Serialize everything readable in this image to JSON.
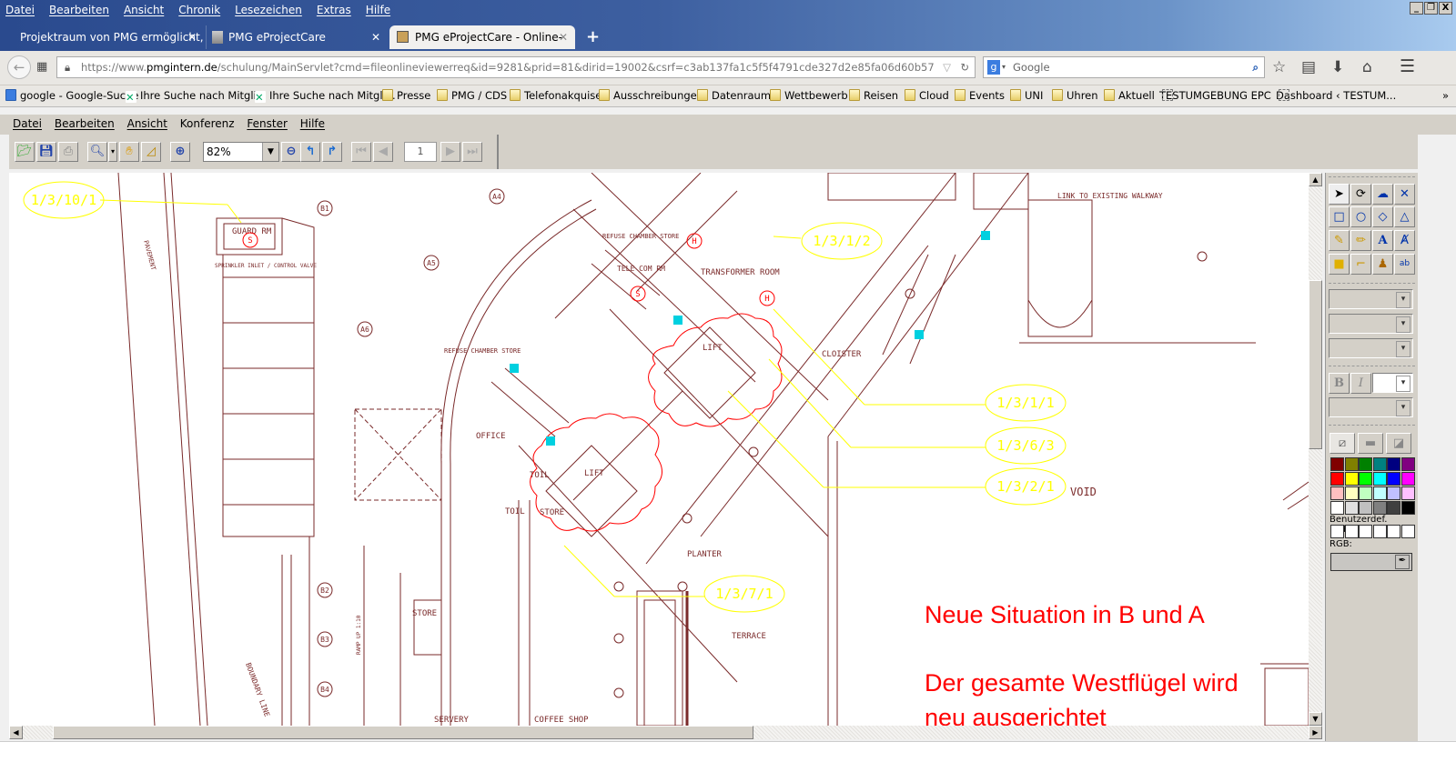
{
  "browser": {
    "menu": [
      "Datei",
      "Bearbeiten",
      "Ansicht",
      "Chronik",
      "Lesezeichen",
      "Extras",
      "Hilfe"
    ],
    "window_controls": [
      "_",
      "❐",
      "X"
    ],
    "tabs": [
      {
        "label": "Projektraum von PMG ermöglicht, ...",
        "active": false
      },
      {
        "label": "PMG eProjectCare (Schulung)",
        "active": false
      },
      {
        "label": "PMG eProjectCare - Online-D...",
        "active": true
      }
    ],
    "new_tab": "+",
    "close_glyph": "✕",
    "url_prefix": "https://www.",
    "url_domain": "pmgintern.de",
    "url_path": "/schulung/MainServlet?cmd=fileonlineviewerreq&id=9281&prid=81&dirid=19002&csrf=c3ab137fa1c5f5f4791cde327d2e85fa06d60b57",
    "search_placeholder": "Google",
    "bookmarks": [
      {
        "label": "google - Google-Suche",
        "icon": "google"
      },
      {
        "label": "Ihre Suche nach Mitgli...",
        "icon": "xing"
      },
      {
        "label": "Ihre Suche nach Mitgli...",
        "icon": "xing"
      },
      {
        "label": "Presse",
        "icon": "folder"
      },
      {
        "label": "PMG / CDS",
        "icon": "folder"
      },
      {
        "label": "Telefonakquise",
        "icon": "folder"
      },
      {
        "label": "Ausschreibungen",
        "icon": "folder"
      },
      {
        "label": "Datenraum",
        "icon": "folder"
      },
      {
        "label": "Wettbewerb",
        "icon": "folder"
      },
      {
        "label": "Reisen",
        "icon": "folder"
      },
      {
        "label": "Cloud",
        "icon": "folder"
      },
      {
        "label": "Events",
        "icon": "folder"
      },
      {
        "label": "UNI",
        "icon": "folder"
      },
      {
        "label": "Uhren",
        "icon": "folder"
      },
      {
        "label": "Aktuell",
        "icon": "folder"
      },
      {
        "label": "TESTUMGEBUNG EPC",
        "icon": "page"
      },
      {
        "label": "Dashboard ‹ TESTUM...",
        "icon": "page"
      }
    ],
    "bookmarks_overflow": "»"
  },
  "viewer": {
    "menu": [
      "Datei",
      "Bearbeiten",
      "Ansicht",
      "Konferenz",
      "Fenster",
      "Hilfe"
    ],
    "zoom": "82%",
    "page": "1",
    "panel": {
      "custom_colors_label": "Benutzerdef. Farben:",
      "rgb_label": "RGB:",
      "bold": "B",
      "italic": "I",
      "palette": [
        "#800000",
        "#808000",
        "#008000",
        "#008080",
        "#000080",
        "#800080",
        "#ff0000",
        "#ffff00",
        "#00ff00",
        "#00ffff",
        "#0000ff",
        "#ff00ff",
        "#ffc0c0",
        "#ffffc0",
        "#c0ffc0",
        "#c0ffff",
        "#c0c0ff",
        "#ffc0ff",
        "#ffffff",
        "#e0e0e0",
        "#c0c0c0",
        "#808080",
        "#404040",
        "#000000"
      ]
    }
  },
  "drawing": {
    "colors": {
      "lines": "#7a2a2a",
      "markup": "#ff0000",
      "callout": "#ffff00",
      "cyan": "#00d0e0"
    },
    "rooms": [
      "GUARD RM",
      "SPRINKLER INLET / CONTROL VALVE",
      "PAVEMENT",
      "REFUSE CHAMBER STORE",
      "TELE COM RM",
      "TRANSFORMER ROOM",
      "REFUSE CHAMBER STORE",
      "LIFT",
      "CLOISTER",
      "OFFICE",
      "TOIL",
      "LIFT",
      "TOIL",
      "STORE",
      "PLANTER",
      "STORE",
      "TERRACE",
      "SERVERY",
      "COFFEE SHOP",
      "BOUNDARY LINE",
      "RAMP UP 1:10",
      "LINK TO EXISTING WALKWAY",
      "VOID"
    ],
    "grid_markers": [
      "B1",
      "A4",
      "A5",
      "A6",
      "B2",
      "B3",
      "B4"
    ],
    "callouts": [
      "1/3/10/1",
      "1/3/1/2",
      "1/3/1/1",
      "1/3/6/3",
      "1/3/2/1",
      "1/3/7/1"
    ],
    "symbols": [
      "H",
      "H",
      "S",
      "S"
    ],
    "notes": [
      "Neue Situation in B und A",
      "Der gesamte Westflügel wird",
      "neu ausgerichtet"
    ]
  }
}
